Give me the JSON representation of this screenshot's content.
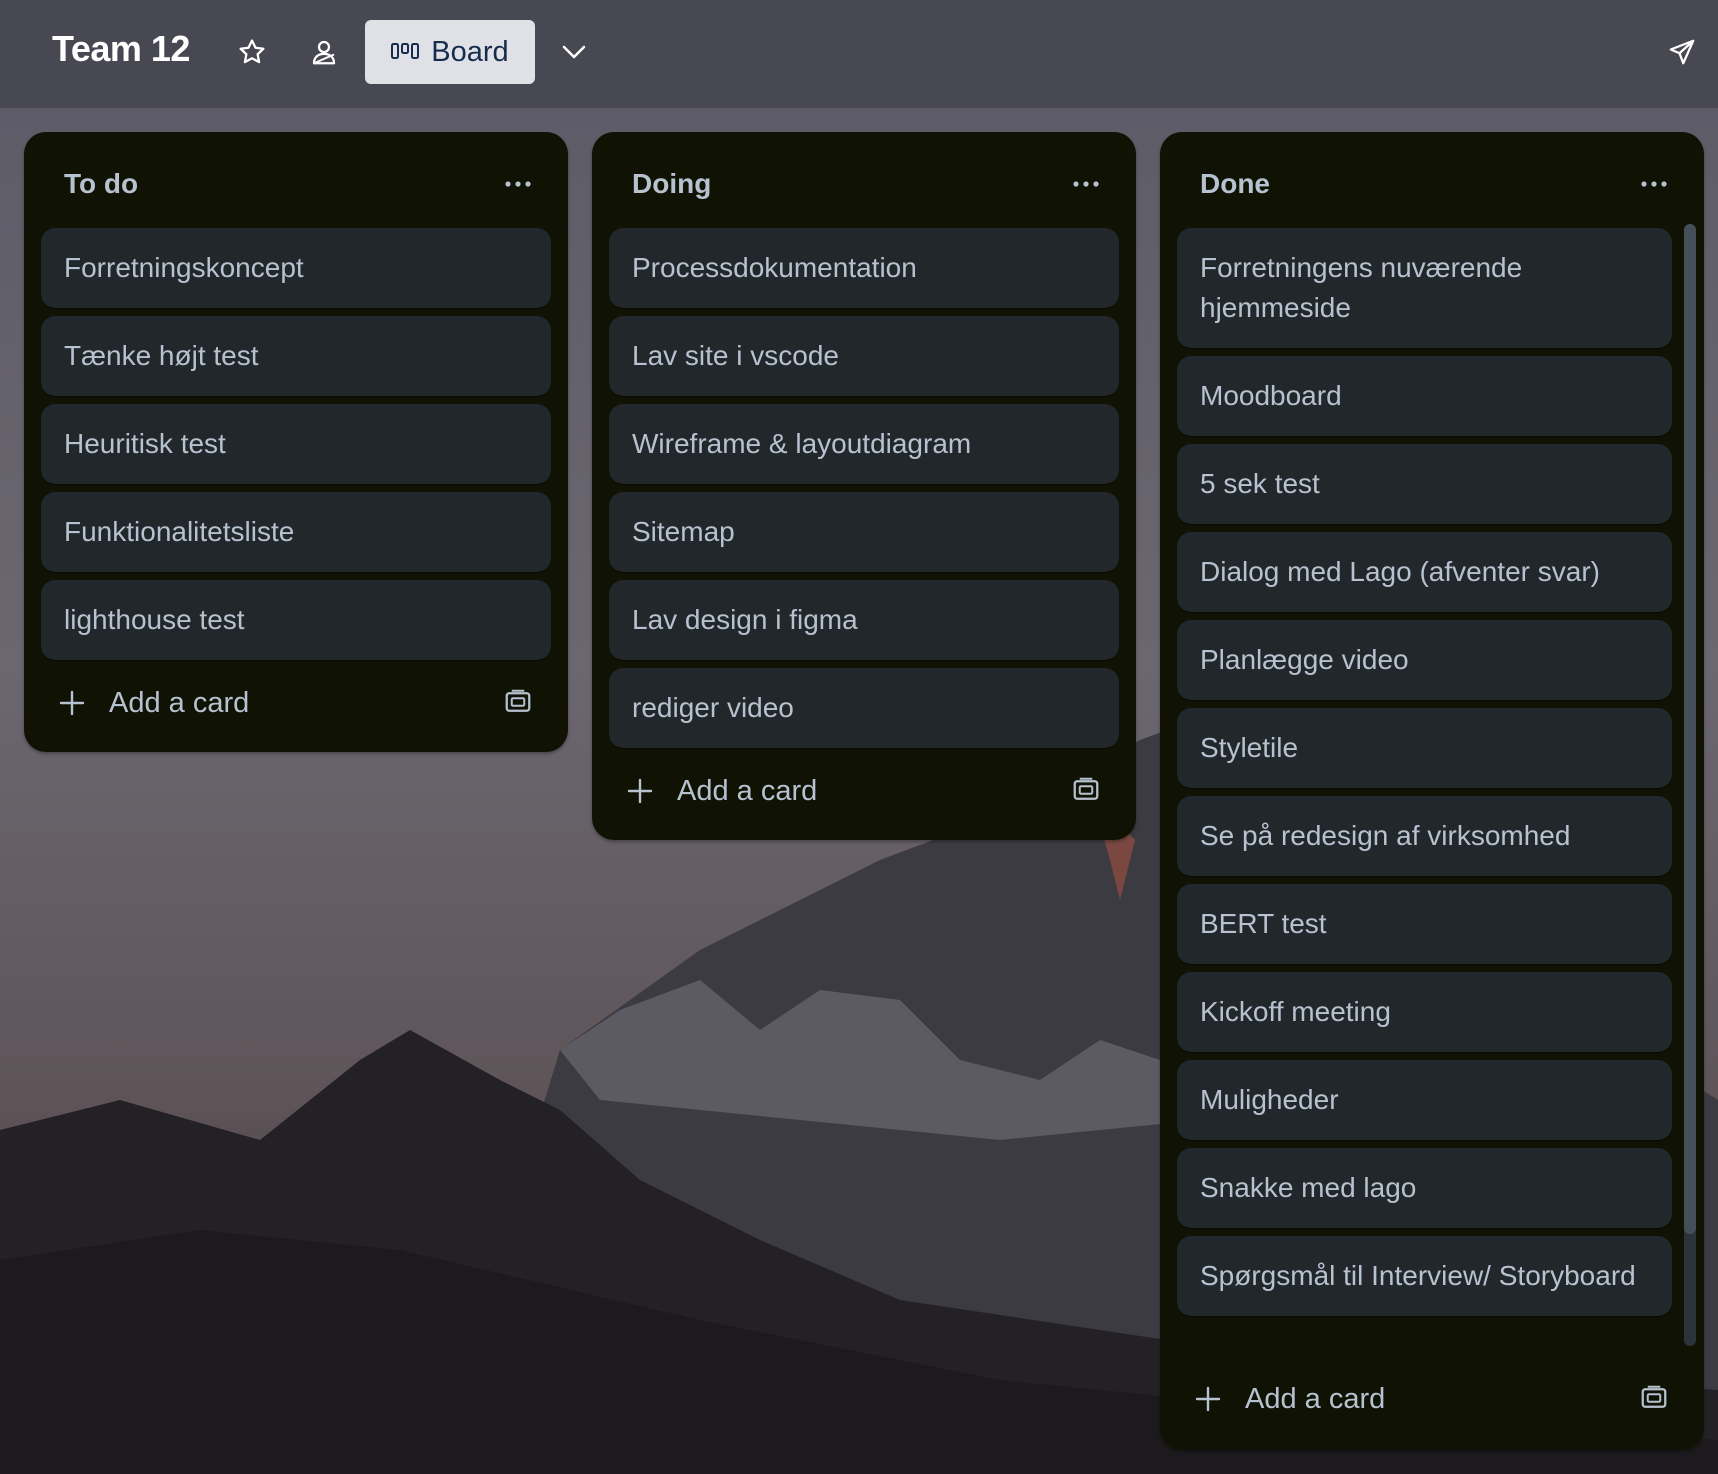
{
  "header": {
    "board_title": "Team 12",
    "view_label": "Board",
    "icons": {
      "star": "star-icon",
      "members": "members-icon",
      "view": "board-view-icon",
      "chevron": "chevron-down-icon",
      "share": "send-icon"
    }
  },
  "lists": [
    {
      "title": "To do",
      "cards": [
        "Forretningskoncept",
        "Tænke højt test",
        "Heuritisk test",
        "Funktionalitetsliste",
        "lighthouse test"
      ],
      "add_label": "Add a card"
    },
    {
      "title": "Doing",
      "cards": [
        "Processdokumentation",
        "Lav site i vscode",
        "Wireframe & layoutdiagram",
        "Sitemap",
        "Lav design i figma",
        "rediger video"
      ],
      "add_label": "Add a card"
    },
    {
      "title": "Done",
      "cards": [
        "Forretningens nuværende hjemmeside",
        "Moodboard",
        "5 sek test",
        "Dialog med Lago (afventer svar)",
        "Planlægge video",
        "Styletile",
        "Se på redesign af virksomhed",
        "BERT test",
        "Kickoff meeting",
        "Muligheder",
        "Snakke med lago",
        "Spørgsmål til Interview/ Storyboard"
      ],
      "add_label": "Add a card"
    }
  ],
  "colors": {
    "list_bg": "#101204",
    "card_bg": "#22272b",
    "text": "#b6c2cf",
    "view_button_bg": "#dfe1e6"
  }
}
